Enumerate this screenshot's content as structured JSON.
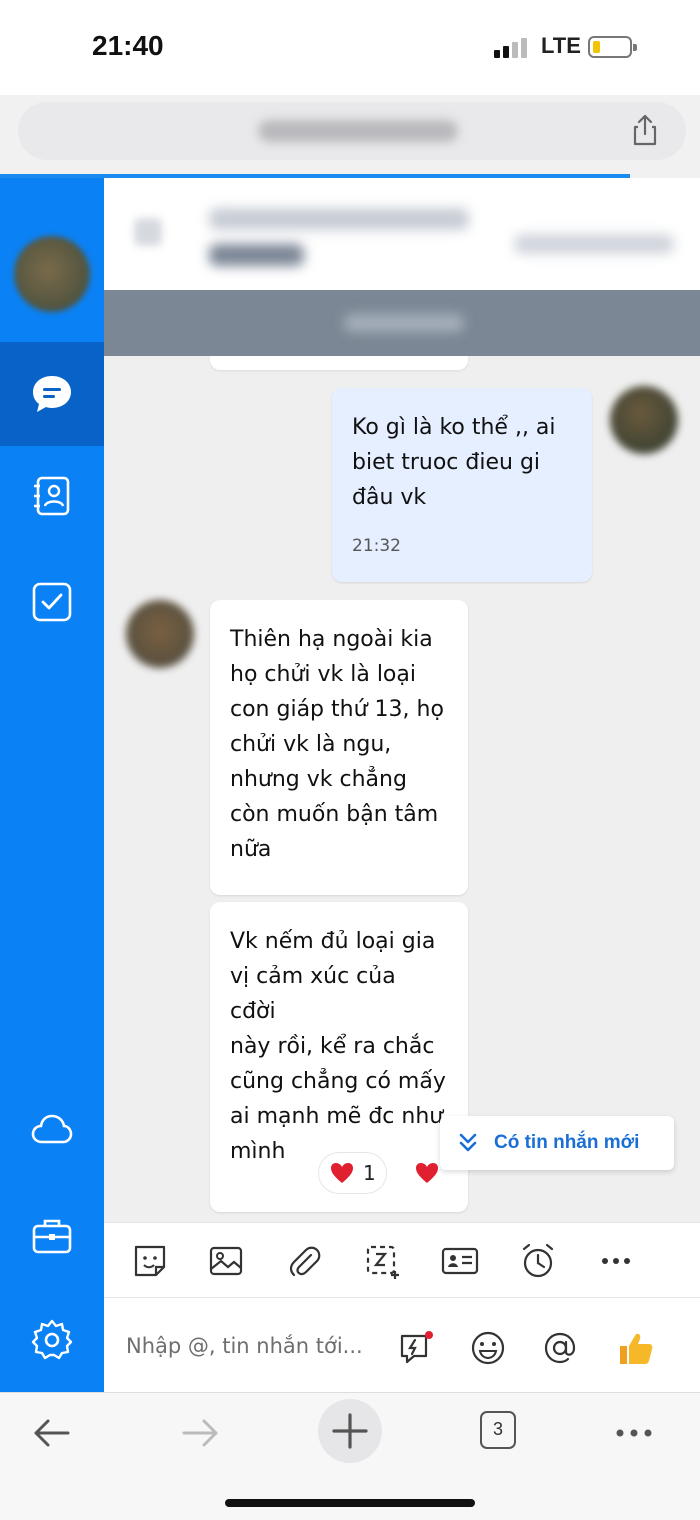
{
  "status_bar": {
    "time": "21:40",
    "network": "LTE"
  },
  "browser": {
    "url_blurred": true,
    "tab_count": "3"
  },
  "messages": [
    {
      "sender": "me",
      "text": "Ko gì là ko thể ,, ai\nbiet truoc đieu gi\nđâu vk",
      "time": "21:32"
    },
    {
      "sender": "other",
      "text": "Thiên hạ ngoài kia\nhọ chửi vk là loại\ncon giáp thứ 13, họ\nchửi vk là ngu,\nnhưng vk chẳng\ncòn muốn bận tâm\nnữa"
    },
    {
      "sender": "other",
      "text": "Vk nếm đủ loại gia\nvị cảm xúc của cđời\nnày rồi, kể ra chắc\ncũng chẳng có mấy\nai mạnh mẽ đc như\nmình"
    }
  ],
  "reaction": {
    "count": "1"
  },
  "new_message_banner": "Có tin nhắn mới",
  "composer": {
    "placeholder": "Nhập @, tin nhắn tới..."
  },
  "colors": {
    "sidebar": "#0a82f5",
    "sidebar_active": "#0862c8",
    "my_bubble": "#e5efff",
    "accent": "#1a6fd6"
  },
  "icons": {
    "sidebar": [
      "chat-icon",
      "contacts-icon",
      "todo-icon",
      "cloud-icon",
      "toolbox-icon",
      "settings-icon"
    ],
    "toolbar": [
      "sticker-icon",
      "image-icon",
      "attachment-icon",
      "screenshot-icon",
      "contact-card-icon",
      "reminder-icon",
      "more-icon"
    ],
    "composer": [
      "quick-message-icon",
      "emoji-icon",
      "mention-icon",
      "like-icon"
    ]
  }
}
